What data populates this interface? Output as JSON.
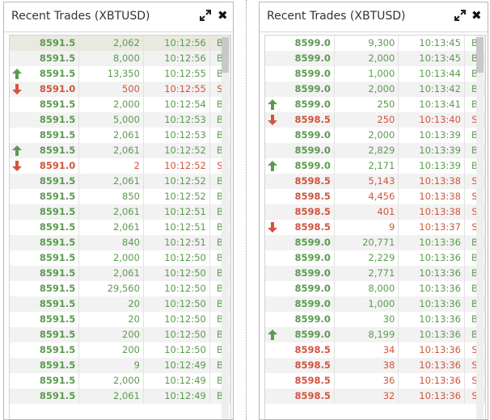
{
  "panels": [
    {
      "title": "Recent Trades (XBTUSD)",
      "icons": {
        "expand": "expand-icon",
        "close": "close-icon",
        "close_glyph": "✖"
      },
      "trades": [
        {
          "price": "8591.5",
          "size": "2,062",
          "time": "10:12:56",
          "side": "B",
          "arrow": ""
        },
        {
          "price": "8591.5",
          "size": "8,000",
          "time": "10:12:56",
          "side": "B",
          "arrow": ""
        },
        {
          "price": "8591.5",
          "size": "13,350",
          "time": "10:12:55",
          "side": "B",
          "arrow": "up"
        },
        {
          "price": "8591.0",
          "size": "500",
          "time": "10:12:55",
          "side": "S",
          "arrow": "down"
        },
        {
          "price": "8591.5",
          "size": "2,000",
          "time": "10:12:54",
          "side": "B",
          "arrow": ""
        },
        {
          "price": "8591.5",
          "size": "5,000",
          "time": "10:12:53",
          "side": "B",
          "arrow": ""
        },
        {
          "price": "8591.5",
          "size": "2,061",
          "time": "10:12:53",
          "side": "B",
          "arrow": ""
        },
        {
          "price": "8591.5",
          "size": "2,061",
          "time": "10:12:52",
          "side": "B",
          "arrow": "up"
        },
        {
          "price": "8591.0",
          "size": "2",
          "time": "10:12:52",
          "side": "S",
          "arrow": "down"
        },
        {
          "price": "8591.5",
          "size": "2,061",
          "time": "10:12:52",
          "side": "B",
          "arrow": ""
        },
        {
          "price": "8591.5",
          "size": "850",
          "time": "10:12:52",
          "side": "B",
          "arrow": ""
        },
        {
          "price": "8591.5",
          "size": "2,061",
          "time": "10:12:51",
          "side": "B",
          "arrow": ""
        },
        {
          "price": "8591.5",
          "size": "2,061",
          "time": "10:12:51",
          "side": "B",
          "arrow": ""
        },
        {
          "price": "8591.5",
          "size": "840",
          "time": "10:12:51",
          "side": "B",
          "arrow": ""
        },
        {
          "price": "8591.5",
          "size": "2,000",
          "time": "10:12:50",
          "side": "B",
          "arrow": ""
        },
        {
          "price": "8591.5",
          "size": "2,061",
          "time": "10:12:50",
          "side": "B",
          "arrow": ""
        },
        {
          "price": "8591.5",
          "size": "29,560",
          "time": "10:12:50",
          "side": "B",
          "arrow": ""
        },
        {
          "price": "8591.5",
          "size": "20",
          "time": "10:12:50",
          "side": "B",
          "arrow": ""
        },
        {
          "price": "8591.5",
          "size": "20",
          "time": "10:12:50",
          "side": "B",
          "arrow": ""
        },
        {
          "price": "8591.5",
          "size": "200",
          "time": "10:12:50",
          "side": "B",
          "arrow": ""
        },
        {
          "price": "8591.5",
          "size": "200",
          "time": "10:12:50",
          "side": "B",
          "arrow": ""
        },
        {
          "price": "8591.5",
          "size": "9",
          "time": "10:12:49",
          "side": "B",
          "arrow": ""
        },
        {
          "price": "8591.5",
          "size": "2,000",
          "time": "10:12:49",
          "side": "B",
          "arrow": ""
        },
        {
          "price": "8591.5",
          "size": "2,061",
          "time": "10:12:49",
          "side": "B",
          "arrow": ""
        }
      ]
    },
    {
      "title": "Recent Trades (XBTUSD)",
      "icons": {
        "expand": "expand-icon",
        "close": "close-icon",
        "close_glyph": "✖"
      },
      "trades": [
        {
          "price": "8599.0",
          "size": "9,300",
          "time": "10:13:45",
          "side": "B",
          "arrow": ""
        },
        {
          "price": "8599.0",
          "size": "2,000",
          "time": "10:13:45",
          "side": "B",
          "arrow": ""
        },
        {
          "price": "8599.0",
          "size": "1,000",
          "time": "10:13:44",
          "side": "B",
          "arrow": ""
        },
        {
          "price": "8599.0",
          "size": "2,000",
          "time": "10:13:42",
          "side": "B",
          "arrow": ""
        },
        {
          "price": "8599.0",
          "size": "250",
          "time": "10:13:41",
          "side": "B",
          "arrow": "up"
        },
        {
          "price": "8598.5",
          "size": "250",
          "time": "10:13:40",
          "side": "S",
          "arrow": "down"
        },
        {
          "price": "8599.0",
          "size": "2,000",
          "time": "10:13:39",
          "side": "B",
          "arrow": ""
        },
        {
          "price": "8599.0",
          "size": "2,829",
          "time": "10:13:39",
          "side": "B",
          "arrow": ""
        },
        {
          "price": "8599.0",
          "size": "2,171",
          "time": "10:13:39",
          "side": "B",
          "arrow": "up"
        },
        {
          "price": "8598.5",
          "size": "5,143",
          "time": "10:13:38",
          "side": "S",
          "arrow": ""
        },
        {
          "price": "8598.5",
          "size": "4,456",
          "time": "10:13:38",
          "side": "S",
          "arrow": ""
        },
        {
          "price": "8598.5",
          "size": "401",
          "time": "10:13:38",
          "side": "S",
          "arrow": ""
        },
        {
          "price": "8598.5",
          "size": "9",
          "time": "10:13:37",
          "side": "S",
          "arrow": "down"
        },
        {
          "price": "8599.0",
          "size": "20,771",
          "time": "10:13:36",
          "side": "B",
          "arrow": ""
        },
        {
          "price": "8599.0",
          "size": "2,229",
          "time": "10:13:36",
          "side": "B",
          "arrow": ""
        },
        {
          "price": "8599.0",
          "size": "2,771",
          "time": "10:13:36",
          "side": "B",
          "arrow": ""
        },
        {
          "price": "8599.0",
          "size": "8,000",
          "time": "10:13:36",
          "side": "B",
          "arrow": ""
        },
        {
          "price": "8599.0",
          "size": "1,000",
          "time": "10:13:36",
          "side": "B",
          "arrow": ""
        },
        {
          "price": "8599.0",
          "size": "30",
          "time": "10:13:36",
          "side": "B",
          "arrow": ""
        },
        {
          "price": "8599.0",
          "size": "8,199",
          "time": "10:13:36",
          "side": "B",
          "arrow": "up"
        },
        {
          "price": "8598.5",
          "size": "34",
          "time": "10:13:36",
          "side": "S",
          "arrow": ""
        },
        {
          "price": "8598.5",
          "size": "38",
          "time": "10:13:36",
          "side": "S",
          "arrow": ""
        },
        {
          "price": "8598.5",
          "size": "36",
          "time": "10:13:36",
          "side": "S",
          "arrow": ""
        },
        {
          "price": "8598.5",
          "size": "32",
          "time": "10:13:36",
          "side": "S",
          "arrow": ""
        }
      ]
    }
  ],
  "colors": {
    "buy": "#5b9b4f",
    "sell": "#d1553c",
    "header_text": "#333333"
  }
}
